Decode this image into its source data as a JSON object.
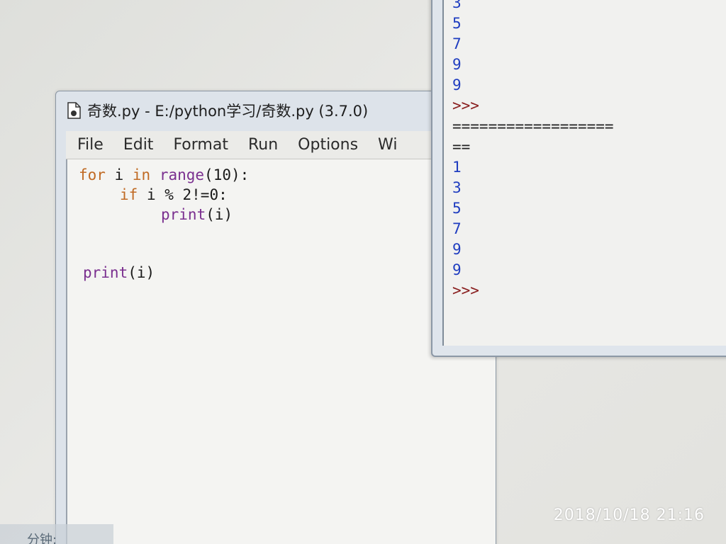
{
  "editor": {
    "title": "奇数.py - E:/python学习/奇数.py (3.7.0)",
    "menu": [
      "File",
      "Edit",
      "Format",
      "Run",
      "Options",
      "Wi"
    ],
    "code": {
      "line1_kw": "for",
      "line1_a": " i ",
      "line1_in": "in",
      "line1_b": " ",
      "line1_fn": "range",
      "line1_c": "(10):",
      "line2_kw": "if",
      "line2_a": " i % 2!=0:",
      "line3_fn": "print",
      "line3_a": "(i)",
      "line4_fn": "print",
      "line4_a": "(i)"
    }
  },
  "shell": {
    "lines": [
      {
        "text": "3",
        "kind": "out"
      },
      {
        "text": "5",
        "kind": "out"
      },
      {
        "text": "7",
        "kind": "out"
      },
      {
        "text": "9",
        "kind": "out"
      },
      {
        "text": "9",
        "kind": "out"
      },
      {
        "text": ">>>",
        "kind": "prompt"
      },
      {
        "text": "==================",
        "kind": "sep"
      },
      {
        "text": "==",
        "kind": "sep"
      },
      {
        "text": "1",
        "kind": "out"
      },
      {
        "text": "3",
        "kind": "out"
      },
      {
        "text": "5",
        "kind": "out"
      },
      {
        "text": "7",
        "kind": "out"
      },
      {
        "text": "9",
        "kind": "out"
      },
      {
        "text": "9",
        "kind": "out"
      },
      {
        "text": ">>>",
        "kind": "prompt"
      }
    ]
  },
  "timestamp": "2018/10/18  21:16",
  "taskbar_label": "分钟:",
  "colors": {
    "keyword": "#c06a24",
    "builtin": "#7a2f8f",
    "shell_output": "#1f3dc0",
    "shell_prompt": "#8a2020"
  }
}
